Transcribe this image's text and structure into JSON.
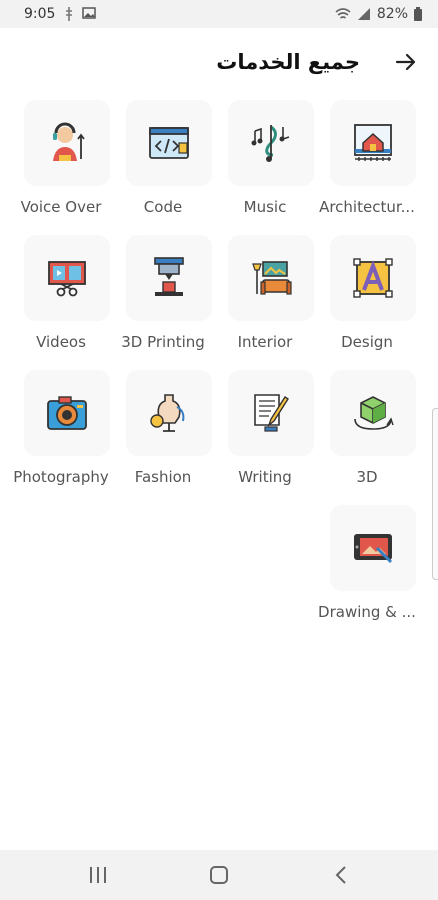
{
  "status": {
    "time": "9:05",
    "battery": "82%"
  },
  "header": {
    "title": "جميع الخدمات"
  },
  "services": [
    {
      "label": "Voice Over",
      "icon": "voice-over-icon"
    },
    {
      "label": "Code",
      "icon": "code-icon"
    },
    {
      "label": "Music",
      "icon": "music-icon"
    },
    {
      "label": "Architectur...",
      "icon": "architecture-icon"
    },
    {
      "label": "Videos",
      "icon": "videos-icon"
    },
    {
      "label": "3D Printing",
      "icon": "3d-printing-icon"
    },
    {
      "label": "Interior",
      "icon": "interior-icon"
    },
    {
      "label": "Design",
      "icon": "design-icon"
    },
    {
      "label": "Photography",
      "icon": "photography-icon"
    },
    {
      "label": "Fashion",
      "icon": "fashion-icon"
    },
    {
      "label": "Writing",
      "icon": "writing-icon"
    },
    {
      "label": "3D",
      "icon": "3d-icon"
    },
    {
      "label": "Drawing & ...",
      "icon": "drawing-icon"
    }
  ],
  "colors": {
    "tile_bg": "#f8f8f8",
    "accent_red": "#e2574c",
    "accent_blue": "#3a7fc1",
    "accent_yellow": "#f5c242",
    "accent_teal": "#4aa3a2"
  }
}
